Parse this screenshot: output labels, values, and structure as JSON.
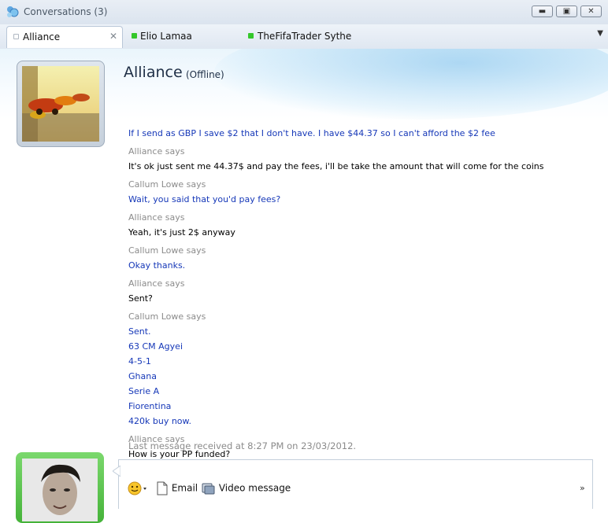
{
  "window": {
    "title": "Conversations (3)"
  },
  "tabs": [
    {
      "label": "Alliance",
      "status_color": "#c4c9d0",
      "active": true
    },
    {
      "label": "Elio Lamaa",
      "status_color": "#34c72b",
      "active": false
    },
    {
      "label": "TheFifaTrader Sythe",
      "status_color": "#34c72b",
      "active": false
    }
  ],
  "contact": {
    "name": "Alliance",
    "status": "(Offline)"
  },
  "conversation": [
    {
      "sender": "",
      "lines": [
        "If I send as GBP I save $2 that I don't have. I have $44.37 so I can't afford the $2 fee"
      ],
      "color": "blue"
    },
    {
      "sender": "Alliance says",
      "lines": [
        "It's ok just sent me 44.37$ and pay the fees, i'll be take the amount that will come for the coins"
      ],
      "color": "black"
    },
    {
      "sender": "Callum Lowe says",
      "lines": [
        "Wait, you said that you'd pay fees?"
      ],
      "color": "blue"
    },
    {
      "sender": "Alliance says",
      "lines": [
        "Yeah, it's just 2$ anyway"
      ],
      "color": "black"
    },
    {
      "sender": "Callum Lowe says",
      "lines": [
        "Okay thanks."
      ],
      "color": "blue"
    },
    {
      "sender": "Alliance says",
      "lines": [
        "Sent?"
      ],
      "color": "black"
    },
    {
      "sender": "Callum Lowe says",
      "lines": [
        "Sent.",
        "63 CM Agyei",
        "4-5-1",
        "Ghana",
        "Serie A",
        "Fiorentina",
        "420k buy now."
      ],
      "color": "blue"
    },
    {
      "sender": "Alliance says",
      "lines": [
        "How is your PP funded?"
      ],
      "color": "black"
    }
  ],
  "last_message": "Last message received at 8:27 PM on 23/03/2012.",
  "compose": {
    "email_label": "Email",
    "video_label": "Video message",
    "more": "»"
  },
  "colors": {
    "accent_blue": "#1638b8",
    "sender_gray": "#8b8b8b",
    "online_green": "#34c72b"
  }
}
